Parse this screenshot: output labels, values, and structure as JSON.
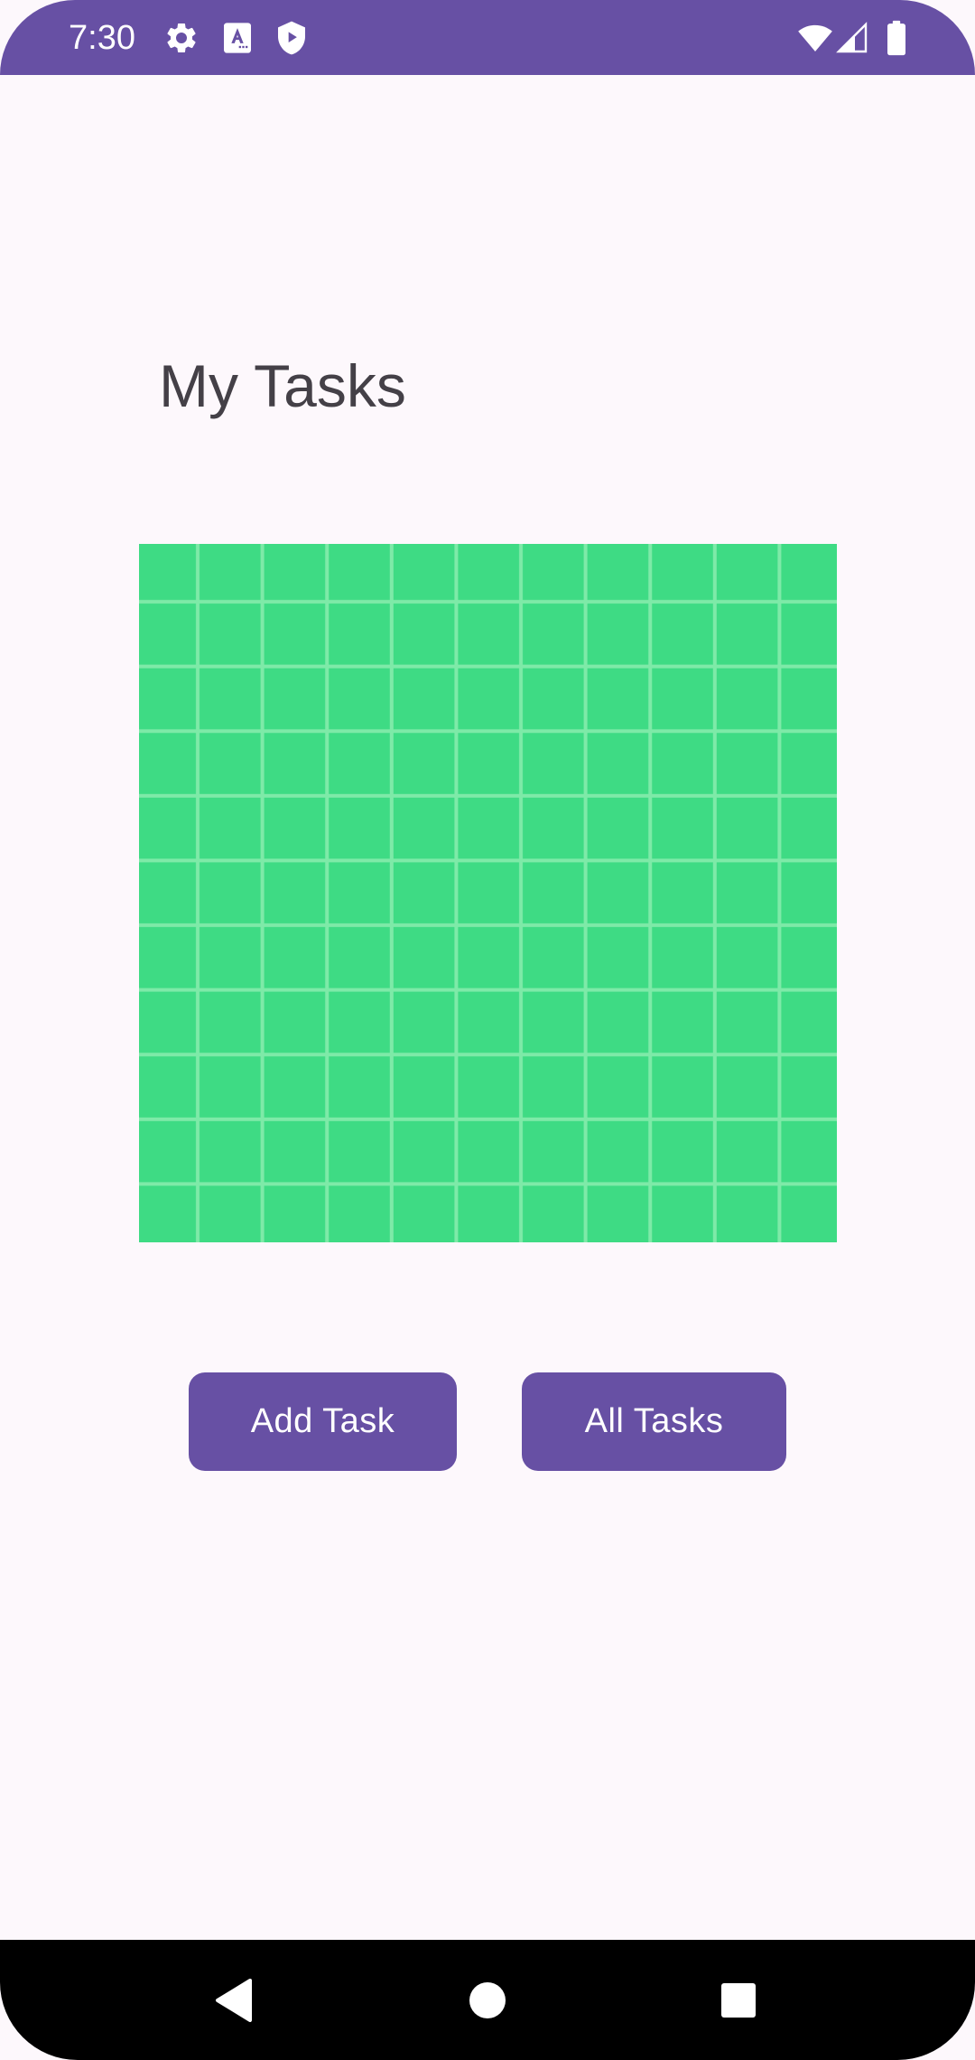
{
  "status_bar": {
    "time": "7:30",
    "background": "#6750A4",
    "left_icons": [
      "gear-icon",
      "font-a-icon",
      "shield-play-icon"
    ],
    "right_icons": [
      "wifi-icon",
      "signal-icon",
      "battery-icon"
    ]
  },
  "main": {
    "title": "My Tasks",
    "image": {
      "icon": "green-grid-image",
      "fill_color": "#3EDB84",
      "line_color": "#7EEAA8"
    },
    "buttons": {
      "add_task_label": "Add Task",
      "all_tasks_label": "All Tasks",
      "color": "#6750A4"
    }
  },
  "nav_bar": {
    "icons": [
      "back-icon",
      "home-icon",
      "recents-icon"
    ],
    "background": "#000000"
  }
}
